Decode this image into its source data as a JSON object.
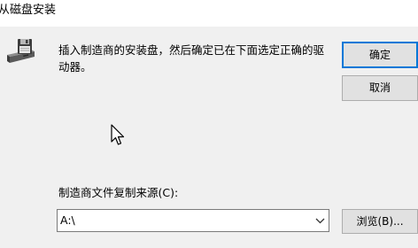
{
  "dialog": {
    "title": "从磁盘安装",
    "message": "插入制造商的安装盘，然后确定已在下面选定正确的驱动器。",
    "ok_label": "确定",
    "cancel_label": "取消",
    "copy_from_label": "制造商文件复制来源(C):",
    "copy_from_value": "A:\\",
    "browse_label": "浏览(B)..."
  },
  "icons": {
    "disk": "floppy-disk-drive-icon",
    "dropdown": "chevron-down-icon",
    "cursor": "mouse-pointer-icon"
  },
  "colors": {
    "window_bg": "#f0f0f0",
    "titlebar_bg": "#ffffff",
    "default_button_border": "#0078d7",
    "button_bg": "#e1e1e1"
  }
}
